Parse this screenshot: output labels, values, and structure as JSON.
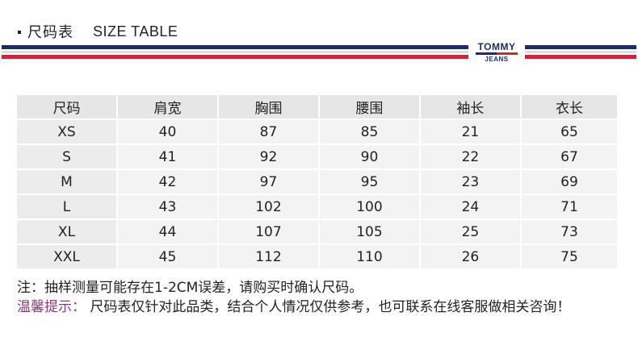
{
  "header": {
    "title_cn": "尺码表",
    "title_en": "SIZE TABLE"
  },
  "logo": {
    "line1": "TOMMY",
    "line2": "JEANS"
  },
  "colors": {
    "navy": "#1d2d5c",
    "red": "#c8283a",
    "tip_purple": "#8a3a78"
  },
  "table": {
    "headers": [
      "尺码",
      "肩宽",
      "胸围",
      "腰围",
      "袖长",
      "衣长"
    ],
    "rows": [
      [
        "XS",
        "40",
        "87",
        "85",
        "21",
        "65"
      ],
      [
        "S",
        "41",
        "92",
        "90",
        "22",
        "67"
      ],
      [
        "M",
        "42",
        "97",
        "95",
        "23",
        "69"
      ],
      [
        "L",
        "43",
        "102",
        "100",
        "24",
        "71"
      ],
      [
        "XL",
        "44",
        "107",
        "105",
        "25",
        "73"
      ],
      [
        "XXL",
        "45",
        "112",
        "110",
        "26",
        "75"
      ]
    ]
  },
  "notes": {
    "note1": "注：抽样测量可能存在1-2CM误差，请购买时确认尺码。",
    "tip_label": "温馨提示：",
    "tip_text": "尺码表仅针对此品类，结合个人情况仅供参考，也可联系在线客服做相关咨询！"
  }
}
